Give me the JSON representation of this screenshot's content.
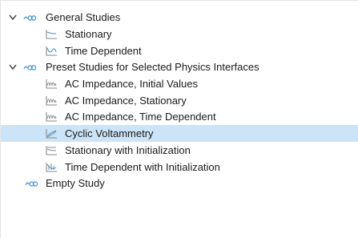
{
  "tree": {
    "groups": [
      {
        "label": "General Studies",
        "icon": "study-group-icon",
        "expanded": true,
        "items": [
          {
            "label": "Stationary",
            "icon": "stationary-study-icon"
          },
          {
            "label": "Time Dependent",
            "icon": "time-dependent-study-icon"
          }
        ]
      },
      {
        "label": "Preset Studies for Selected Physics Interfaces",
        "icon": "study-group-icon",
        "expanded": true,
        "items": [
          {
            "label": "AC Impedance, Initial Values",
            "icon": "ac-impedance-icon"
          },
          {
            "label": "AC Impedance, Stationary",
            "icon": "ac-impedance-icon"
          },
          {
            "label": "AC Impedance, Time Dependent",
            "icon": "ac-impedance-icon"
          },
          {
            "label": "Cyclic Voltammetry",
            "icon": "cyclic-voltammetry-icon",
            "selected": true
          },
          {
            "label": "Stationary with Initialization",
            "icon": "stationary-init-icon"
          },
          {
            "label": "Time Dependent with Initialization",
            "icon": "time-dependent-init-icon"
          }
        ]
      }
    ],
    "empty_study": {
      "label": "Empty Study",
      "icon": "study-group-icon"
    }
  },
  "colors": {
    "selection": "#cce4f7",
    "icon_blue": "#3d8fd6",
    "icon_gray": "#8a8a8a"
  }
}
